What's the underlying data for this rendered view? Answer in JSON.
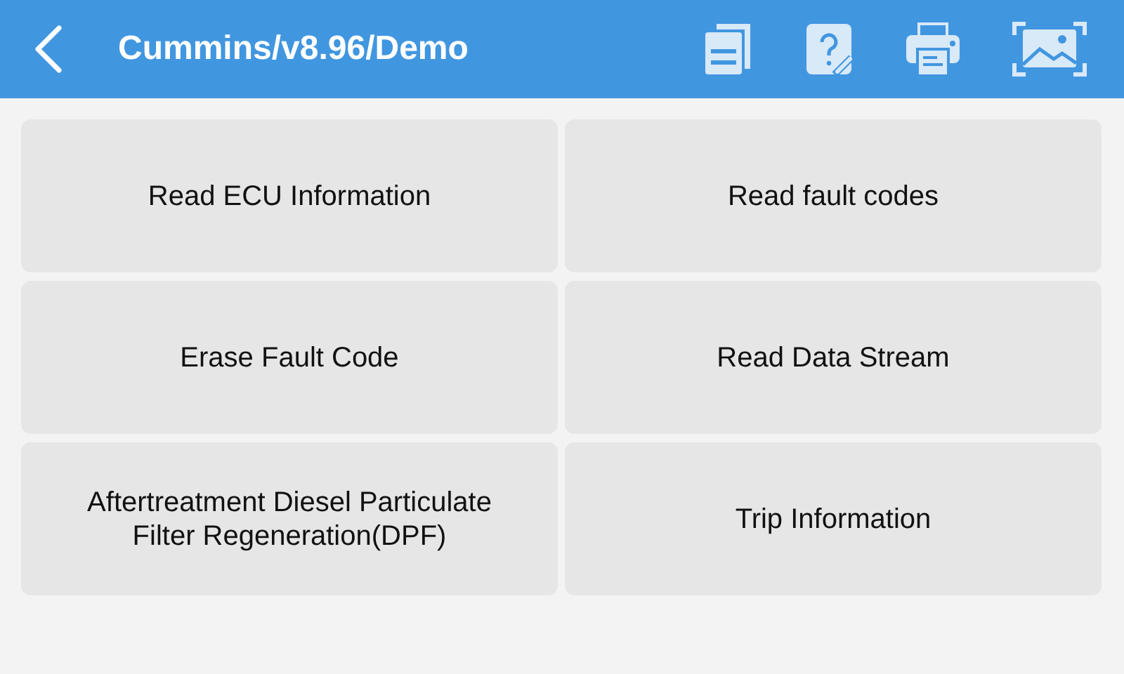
{
  "header": {
    "title": "Cummins/v8.96/Demo"
  },
  "functions": [
    {
      "label": "Read ECU Information"
    },
    {
      "label": "Read fault codes"
    },
    {
      "label": "Erase Fault Code"
    },
    {
      "label": "Read Data Stream"
    },
    {
      "label": "Aftertreatment Diesel Particulate Filter Regeneration(DPF)"
    },
    {
      "label": "Trip Information"
    }
  ]
}
